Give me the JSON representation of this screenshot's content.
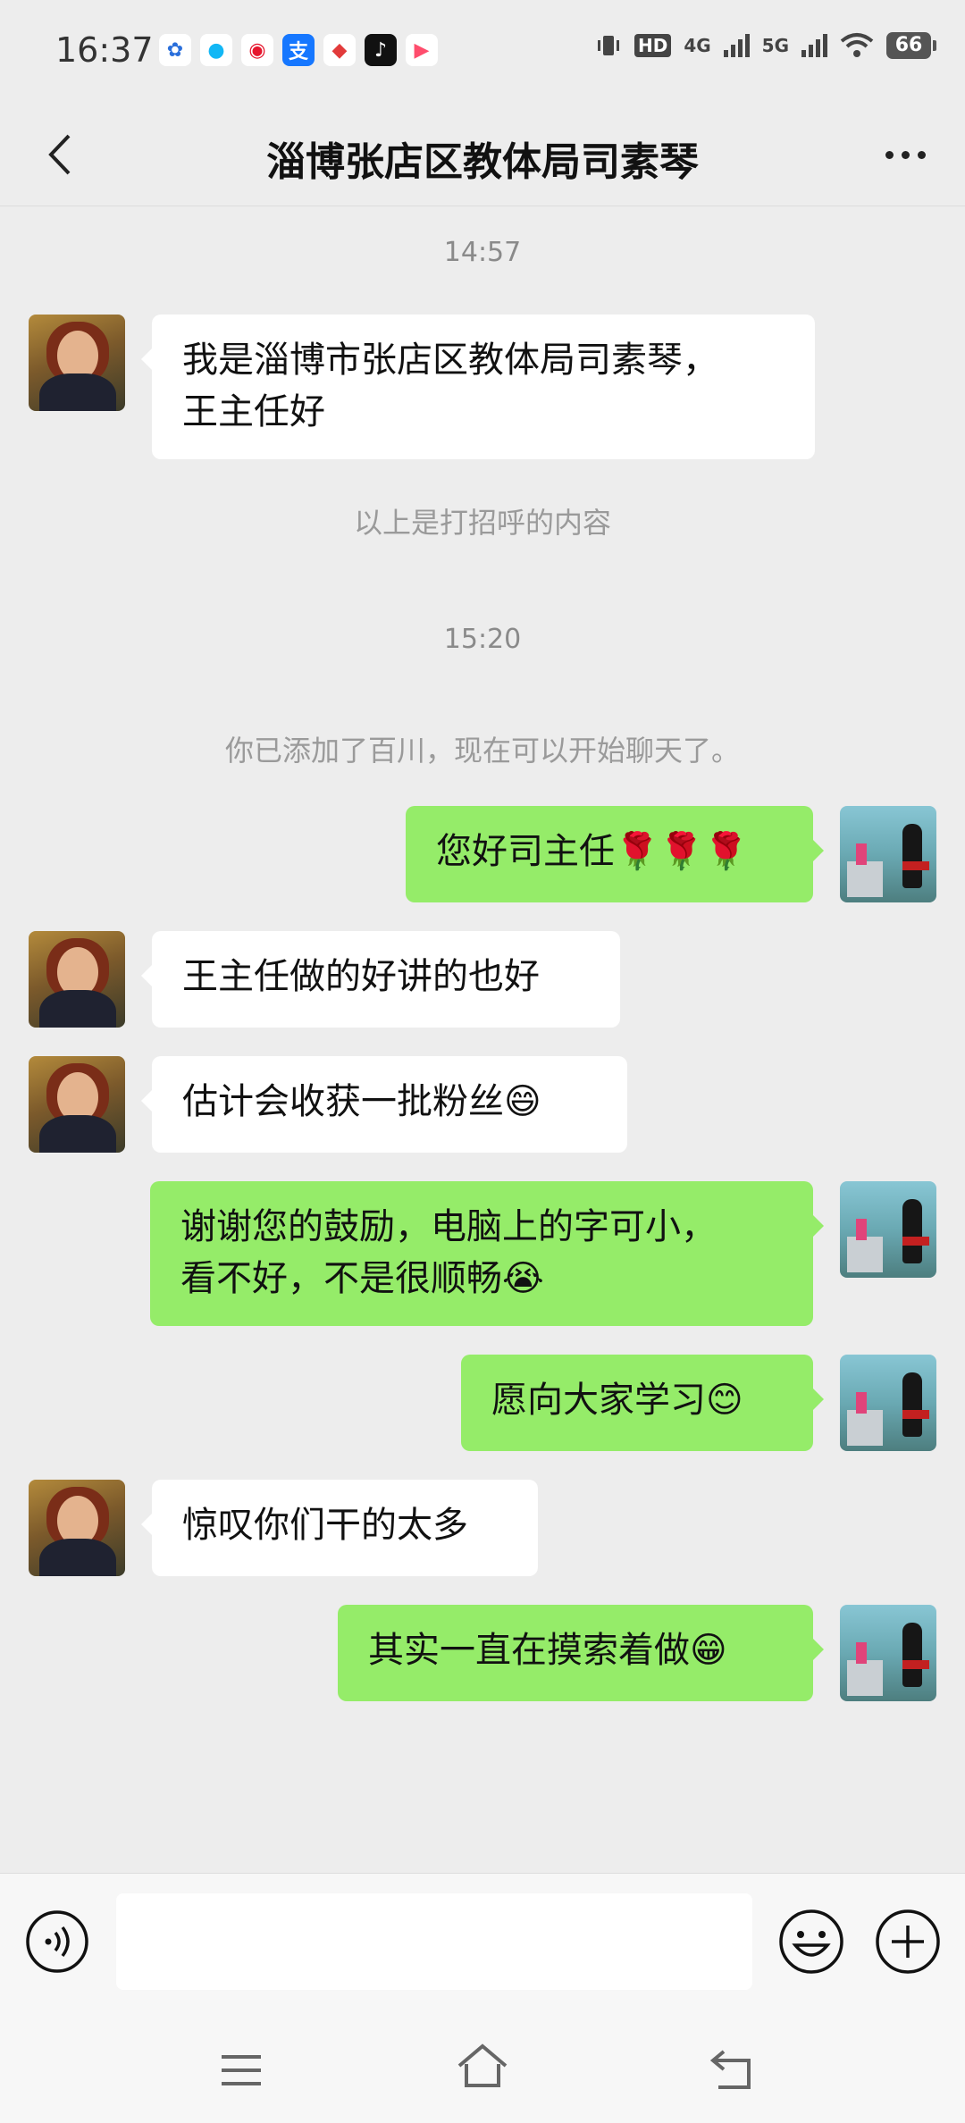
{
  "status_bar": {
    "time": "16:37",
    "app_icons": [
      "baidu-icon",
      "qq-icon",
      "weibo-icon",
      "alipay-icon",
      "maps-icon",
      "tiktok-icon",
      "video-icon"
    ],
    "network_labels": [
      "HD",
      "4G",
      "5G"
    ],
    "battery": "66"
  },
  "header": {
    "title": "淄博张店区教体局司素琴"
  },
  "chat": {
    "timestamp_1": "14:57",
    "msg_1": "我是淄博市张店区教体局司素琴，\n王主任好",
    "system_1": "以上是打招呼的内容",
    "timestamp_2": "15:20",
    "system_2": "你已添加了百川，现在可以开始聊天了。",
    "msg_2": "您好司主任🌹🌹🌹",
    "msg_3": "王主任做的好讲的也好",
    "msg_4": "估计会收获一批粉丝😄",
    "msg_5": "谢谢您的鼓励，电脑上的字可小，\n看不好，不是很顺畅😭",
    "msg_6": "愿向大家学习😊",
    "msg_7": "惊叹你们干的太多",
    "msg_8": "其实一直在摸索着做😁"
  },
  "colors": {
    "background": "#ededed",
    "my_bubble": "#95ec69",
    "their_bubble": "#ffffff"
  }
}
